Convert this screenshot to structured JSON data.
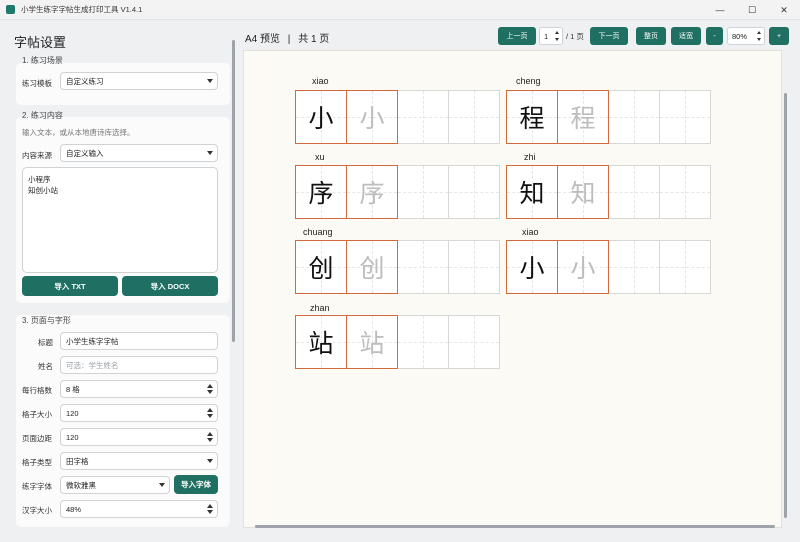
{
  "window": {
    "title": "小学生练字字帖生成打印工具 V1.4.1",
    "minimize": "—",
    "maximize": "☐",
    "close": "✕"
  },
  "sidebar": {
    "title": "字帖设置",
    "scene": {
      "header": "1. 练习场景",
      "template_label": "练习模板",
      "template_value": "自定义练习"
    },
    "content": {
      "header": "2. 练习内容",
      "hint": "输入文本，或从本地唐诗库选择。",
      "source_label": "内容来源",
      "source_value": "自定义输入",
      "text_lines": [
        "小程序",
        "知创小站"
      ],
      "import_txt": "导入 TXT",
      "import_docx": "导入 DOCX"
    },
    "page": {
      "header": "3. 页面与字形",
      "title_label": "标题",
      "title_value": "小学生练字字帖",
      "name_label": "姓名",
      "name_placeholder": "可选：学生姓名",
      "cells_label": "每行格数",
      "cells_value": "8 格",
      "cell_size_label": "格子大小",
      "cell_size_value": "120",
      "margin_label": "页面边距",
      "margin_value": "120",
      "grid_type_label": "格子类型",
      "grid_type_value": "田字格",
      "font_label": "练字字体",
      "font_value": "微软雅黑",
      "import_font": "导入字体",
      "char_size_label": "汉字大小",
      "char_size_value": "48%"
    }
  },
  "preview": {
    "title": "A4 预览",
    "separator": "|",
    "page_count": "共 1 页",
    "prev_page": "上一页",
    "page_input": "1",
    "page_total": "/ 1 页",
    "next_page": "下一页",
    "fit_page": "整页",
    "fit_width": "适宽",
    "zoom_out": "-",
    "zoom_value": "80%",
    "zoom_in": "+",
    "characters": [
      {
        "char": "小",
        "pinyin": "xiao"
      },
      {
        "char": "程",
        "pinyin": "cheng"
      },
      {
        "char": "序",
        "pinyin": "xu"
      },
      {
        "char": "知",
        "pinyin": "zhi"
      },
      {
        "char": "创",
        "pinyin": "chuang"
      },
      {
        "char": "小",
        "pinyin": "xiao"
      },
      {
        "char": "站",
        "pinyin": "zhan"
      }
    ]
  }
}
